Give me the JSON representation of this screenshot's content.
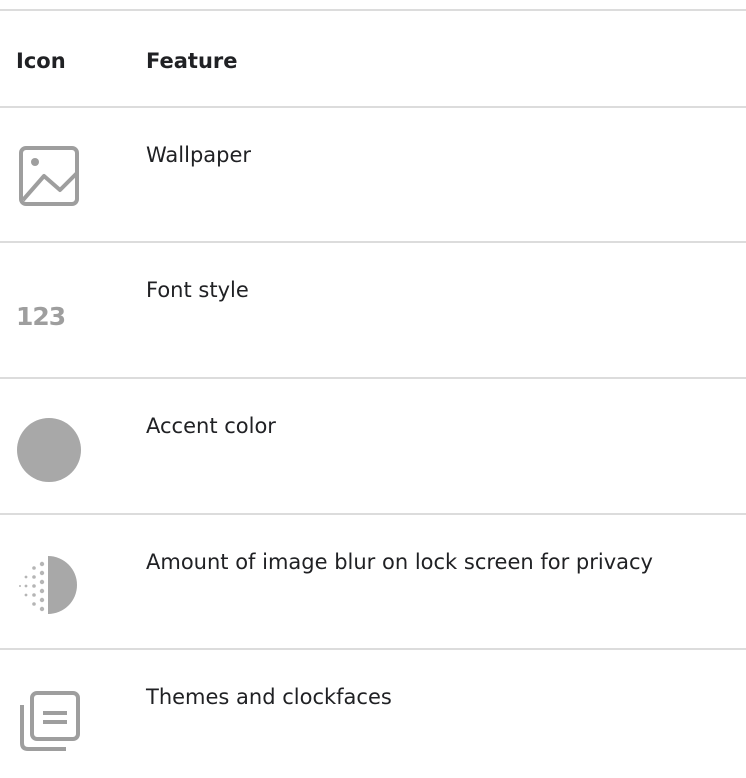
{
  "table": {
    "headers": {
      "icon": "Icon",
      "feature": "Feature"
    },
    "rows": [
      {
        "icon": "wallpaper-icon",
        "feature": "Wallpaper"
      },
      {
        "icon": "font-style-icon",
        "icon_text": "123",
        "feature": "Font style"
      },
      {
        "icon": "accent-color-icon",
        "feature": "Accent color"
      },
      {
        "icon": "blur-icon",
        "feature": "Amount of image blur on lock screen for privacy"
      },
      {
        "icon": "themes-clockfaces-icon",
        "feature": "Themes and clockfaces"
      }
    ]
  },
  "colors": {
    "icon_gray": "#9e9e9e",
    "divider": "#dcdcdc",
    "text": "#202124"
  }
}
